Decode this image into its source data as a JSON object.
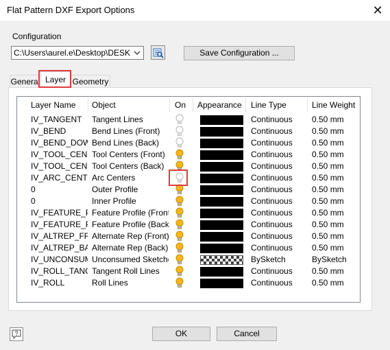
{
  "window": {
    "title": "Flat Pattern DXF Export Options",
    "close_glyph": "✕"
  },
  "configuration": {
    "label": "Configuration",
    "path": "C:\\Users\\aurel.e\\Desktop\\DESKTOP",
    "save_label": "Save Configuration ..."
  },
  "tabs": [
    {
      "label": "General"
    },
    {
      "label": "Layer",
      "selected": true
    },
    {
      "label": "Geometry"
    }
  ],
  "table": {
    "headers": [
      "Layer Name",
      "Object",
      "On",
      "Appearance",
      "Line Type",
      "Line Weight"
    ],
    "rows": [
      {
        "name": "IV_TANGENT",
        "object": "Tangent Lines",
        "on": false,
        "appearance": "black",
        "line_type": "Continuous",
        "line_weight": "0.50 mm"
      },
      {
        "name": "IV_BEND",
        "object": "Bend Lines (Front)",
        "on": false,
        "appearance": "black",
        "line_type": "Continuous",
        "line_weight": "0.50 mm"
      },
      {
        "name": "IV_BEND_DOWN",
        "object": "Bend Lines (Back)",
        "on": false,
        "appearance": "black",
        "line_type": "Continuous",
        "line_weight": "0.50 mm"
      },
      {
        "name": "IV_TOOL_CENTER",
        "object": "Tool Centers (Front)",
        "on": true,
        "appearance": "black",
        "line_type": "Continuous",
        "line_weight": "0.50 mm"
      },
      {
        "name": "IV_TOOL_CENTER",
        "object": "Tool Centers (Back)",
        "on": true,
        "appearance": "black",
        "line_type": "Continuous",
        "line_weight": "0.50 mm"
      },
      {
        "name": "IV_ARC_CENTERS",
        "object": "Arc Centers",
        "on": false,
        "appearance": "black",
        "line_type": "Continuous",
        "line_weight": "0.50 mm"
      },
      {
        "name": "0",
        "object": "Outer Profile",
        "on": true,
        "appearance": "black",
        "line_type": "Continuous",
        "line_weight": "0.50 mm"
      },
      {
        "name": "0",
        "object": "Inner Profile",
        "on": true,
        "appearance": "black",
        "line_type": "Continuous",
        "line_weight": "0.50 mm"
      },
      {
        "name": "IV_FEATURE_PRO",
        "object": "Feature Profile (Front)",
        "on": true,
        "appearance": "black",
        "line_type": "Continuous",
        "line_weight": "0.50 mm"
      },
      {
        "name": "IV_FEATURE_PRO",
        "object": "Feature Profile (Back)",
        "on": true,
        "appearance": "black",
        "line_type": "Continuous",
        "line_weight": "0.50 mm"
      },
      {
        "name": "IV_ALTREP_FRON",
        "object": "Alternate Rep (Front)",
        "on": true,
        "appearance": "black",
        "line_type": "Continuous",
        "line_weight": "0.50 mm"
      },
      {
        "name": "IV_ALTREP_BACK",
        "object": "Alternate Rep (Back)",
        "on": true,
        "appearance": "black",
        "line_type": "Continuous",
        "line_weight": "0.50 mm"
      },
      {
        "name": "IV_UNCONSUMED",
        "object": "Unconsumed Sketches",
        "on": true,
        "appearance": "checker",
        "line_type": "BySketch",
        "line_weight": "BySketch"
      },
      {
        "name": "IV_ROLL_TANGEN",
        "object": "Tangent Roll Lines",
        "on": true,
        "appearance": "black",
        "line_type": "Continuous",
        "line_weight": "0.50 mm"
      },
      {
        "name": "IV_ROLL",
        "object": "Roll Lines",
        "on": true,
        "appearance": "black",
        "line_type": "Continuous",
        "line_weight": "0.50 mm"
      }
    ]
  },
  "buttons": {
    "ok": "OK",
    "cancel": "Cancel"
  },
  "icons": {
    "bulb_on_color": "#f5b81c",
    "bulb_off_color": "#c8c8c8",
    "highlight_color": "#e03b3b"
  }
}
